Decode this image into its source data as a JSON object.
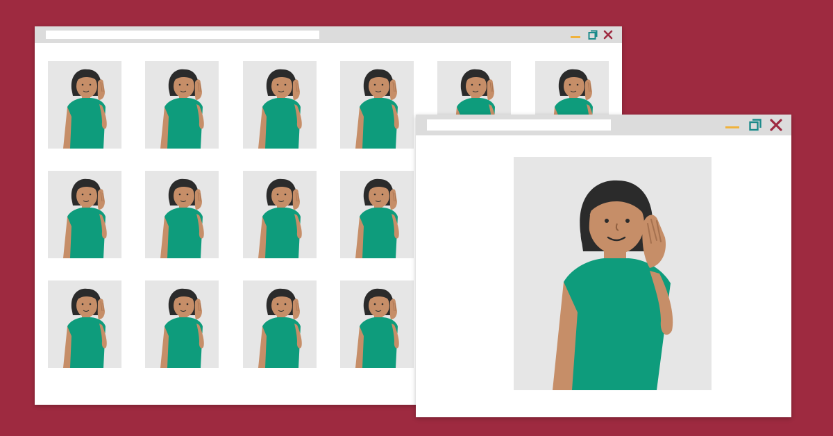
{
  "scene": {
    "background_color": "#9e2a40"
  },
  "gallery_window": {
    "title": "",
    "minimize_icon": "minimize-icon",
    "maximize_icon": "maximize-icon",
    "close_icon": "close-icon",
    "thumbnail_rows": 3,
    "thumbnail_cols": 6
  },
  "speaker_window": {
    "title": "",
    "minimize_icon": "minimize-icon",
    "maximize_icon": "maximize-icon",
    "close_icon": "close-icon"
  },
  "colors": {
    "titlebar": "#dcdcdc",
    "minimize": "#f0b23c",
    "maximize": "#1a8a8a",
    "close": "#9e2a40",
    "shirt": "#0e9c7c",
    "skin": "#c68e68",
    "hair": "#2b2b2b",
    "tile_bg": "#e6e6e6"
  }
}
